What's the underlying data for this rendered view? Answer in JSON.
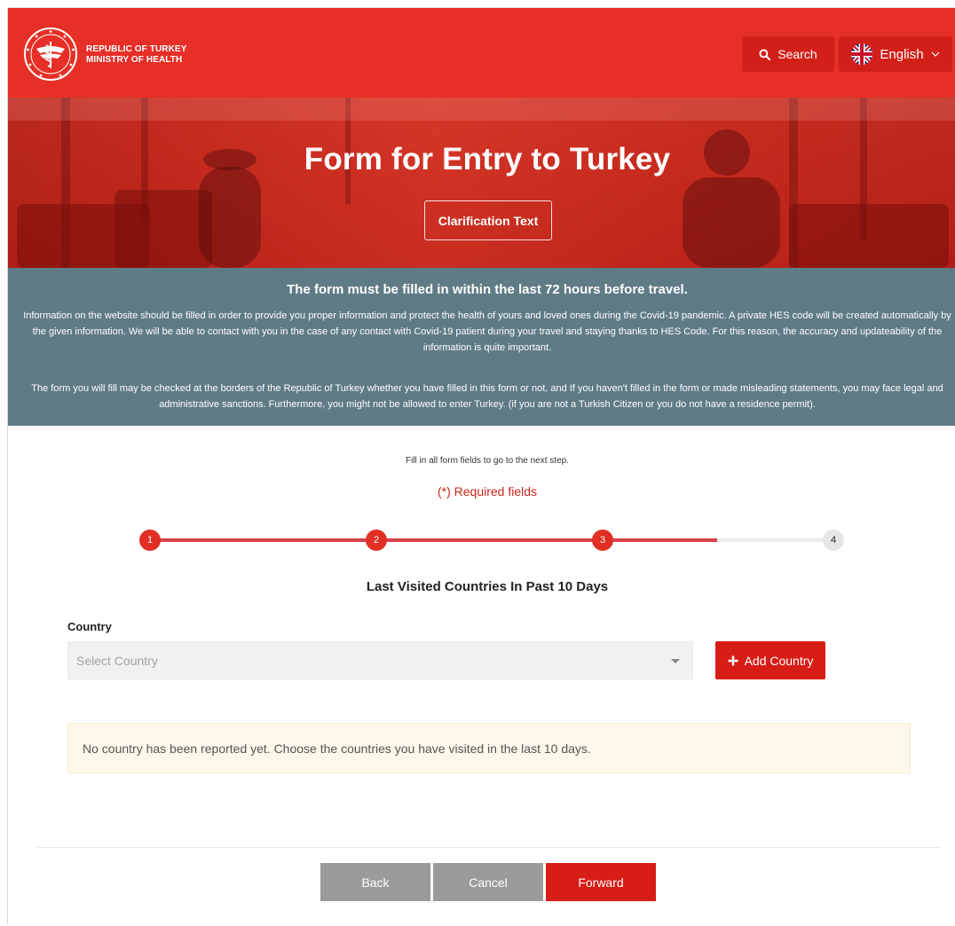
{
  "header": {
    "brand_line1": "REPUBLIC OF TURKEY",
    "brand_line2": "MINISTRY OF HEALTH",
    "search_label": "Search",
    "language_label": "English",
    "icons": {
      "logo": "ministry-logo",
      "search": "search-icon",
      "language": "uk-flag-icon",
      "chevron": "chevron-down-icon"
    }
  },
  "hero": {
    "title": "Form for Entry to Turkey",
    "clarification_label": "Clarification Text"
  },
  "info": {
    "heading": "The form must be filled in within the last 72 hours before travel.",
    "paragraph1": "Information on the website should be filled in order to provide you proper information and protect the health of yours and loved ones during the Covid-19 pandemic. A private HES code will be created automatically by the given information. We will be able to contact with you in the case of any contact with Covid-19 patient during your travel and staying thanks to HES Code. For this reason, the accuracy and updateability of the information is quite important.",
    "paragraph2": "The form you will fill may be checked at the borders of the Republic of Turkey whether you have filled in this form or not, and If you haven't filled in the form or made misleading statements, you may face legal and administrative sanctions. Furthermore, you might not be allowed to enter Turkey. (if you are not a Turkish Citizen or you do not have a residence permit)."
  },
  "form": {
    "note": "Fill in all form fields to go to the next step.",
    "required": "(*) Required fields",
    "steps": [
      "1",
      "2",
      "3",
      "4"
    ],
    "current_step": 3,
    "progress": 0.83,
    "section_title": "Last Visited Countries In Past 10 Days",
    "country_label": "Country",
    "country_placeholder": "Select Country",
    "add_country_label": "Add Country",
    "empty_message": "No country has been reported yet. Choose the countries you have visited in the last 10 days."
  },
  "nav": {
    "back_label": "Back",
    "cancel_label": "Cancel",
    "forward_label": "Forward"
  },
  "colors": {
    "brand_red": "#e63027",
    "button_red": "#d71d16",
    "info_band": "#5f7b86",
    "step_line": "#d9424c",
    "required_text": "#c9261d",
    "alert_bg": "#fdf8e9",
    "nav_gray": "#9b9b9b"
  }
}
